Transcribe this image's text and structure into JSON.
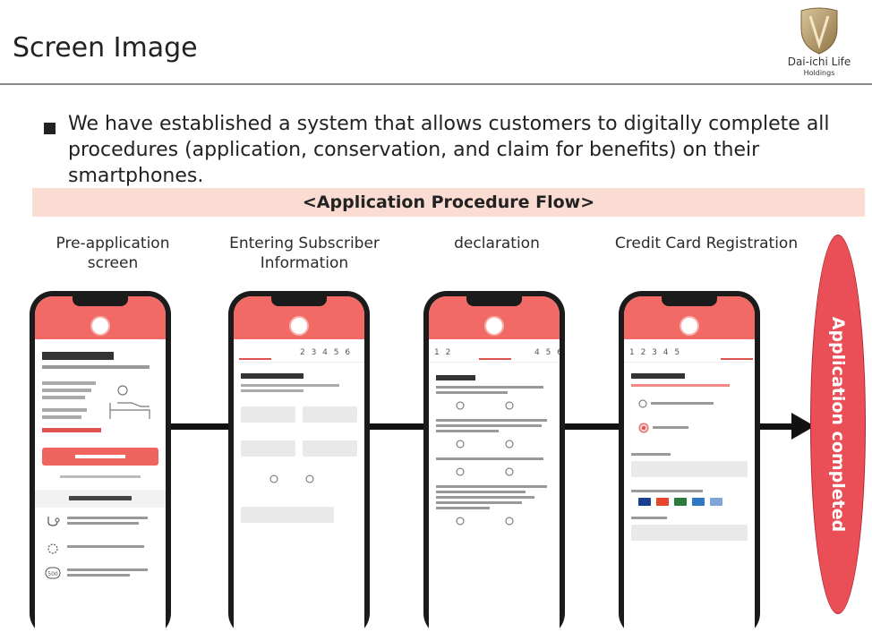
{
  "header": {
    "title": "Screen Image",
    "logo_brand": "Dai-ichi Life",
    "logo_sub": "Holdings"
  },
  "bullet": "We have established a system that allows customers to digitally complete all procedures (application, conservation, and claim for benefits) on their smartphones.",
  "flow_title": "<Application Procedure Flow>",
  "steps": [
    {
      "label": "Pre-application screen"
    },
    {
      "label": "Entering Subscriber Information"
    },
    {
      "label": "declaration"
    },
    {
      "label": "Credit Card Registration"
    }
  ],
  "completed_label": "Application completed",
  "colors": {
    "accent_red": "#f26a66",
    "completed_fill": "#ea4f57",
    "flow_band": "#fbdcd3"
  }
}
